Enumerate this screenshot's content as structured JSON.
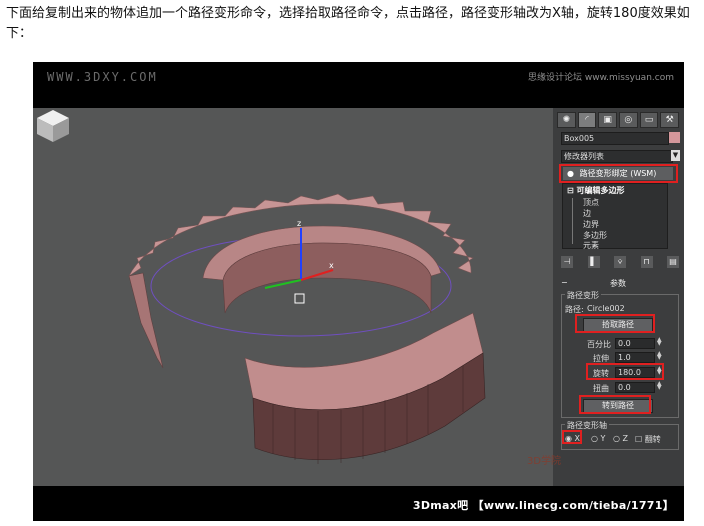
{
  "caption": "下面给复制出来的物体追加一个路径变形命令，选择拾取路径命令，点击路径，路径变形轴改为X轴，旋转180度效果如下：",
  "watermark_left": "WWW.3DXY.COM",
  "watermark_right": "思缘设计论坛 www.missyuan.com",
  "bottom_watermark": "3Dmax吧 【www.linecg.com/tieba/1771】",
  "corner_watermark": "3D学院",
  "panel": {
    "tabs": [
      "✺",
      "◜",
      "▣",
      "◎",
      "▭",
      "⚒"
    ],
    "object_name": "Box005",
    "object_color": "#d4979b",
    "modifier_list": "修改器列表",
    "stack_top": "路径变形绑定 (WSM)",
    "stack_group": "可编辑多边形",
    "stack_items": [
      "顶点",
      "边",
      "边界",
      "多边形",
      "元素"
    ],
    "rollout_title": "参数",
    "group_title": "路径变形",
    "path_label": "路径:",
    "path_value": "Circle002",
    "pick_path_button": "拾取路径",
    "percent_label": "百分比",
    "percent_value": "0.0",
    "stretch_label": "拉伸",
    "stretch_value": "1.0",
    "rotation_label": "旋转",
    "rotation_value": "180.0",
    "twist_label": "扭曲",
    "twist_value": "0.0",
    "move_to_path_button": "转到路径",
    "axis_group_title": "路径变形轴",
    "axis_x": "X",
    "axis_y": "Y",
    "axis_z": "Z",
    "flip_label": "翻转"
  }
}
